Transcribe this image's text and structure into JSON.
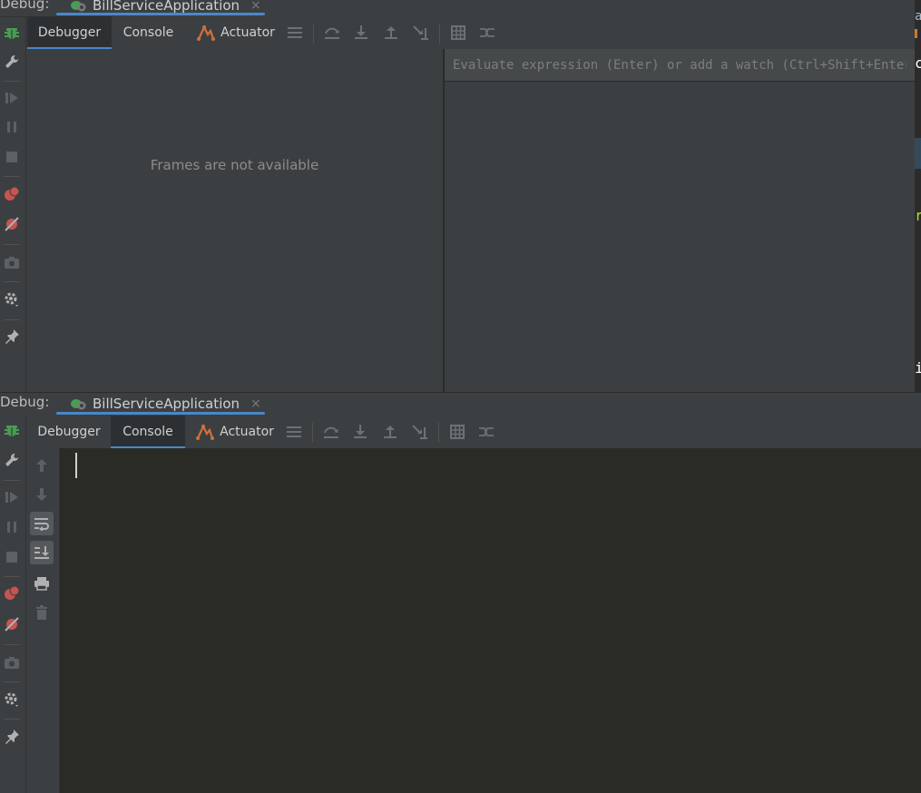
{
  "top_panel": {
    "debug_label": "Debug:",
    "run_config": "BillServiceApplication",
    "close_glyph": "×",
    "tabs": [
      "Debugger",
      "Console",
      "Actuator"
    ],
    "active_tab": "Debugger",
    "frames_message": "Frames are not available",
    "evaluate_placeholder": "Evaluate expression (Enter) or add a watch (Ctrl+Shift+Enter)"
  },
  "bottom_panel": {
    "debug_label": "Debug:",
    "run_config": "BillServiceApplication",
    "close_glyph": "×",
    "tabs": [
      "Debugger",
      "Console",
      "Actuator"
    ],
    "active_tab": "Console",
    "console_text": ""
  },
  "left_toolbar_icons": [
    "bug-icon",
    "wrench-icon",
    "resume-icon",
    "pause-icon",
    "stop-icon",
    "view-breakpoints-icon",
    "mute-breakpoints-icon",
    "camera-icon",
    "settings-icon",
    "pin-icon"
  ],
  "toolbar_icons": [
    "menu-icon",
    "step-over-icon",
    "step-into-icon",
    "step-out-icon",
    "run-to-cursor-icon",
    "evaluate-icon",
    "trace-icon"
  ],
  "console_side_icons": [
    "up-icon",
    "down-icon",
    "soft-wrap-icon",
    "scroll-to-end-icon",
    "print-icon",
    "trash-icon"
  ],
  "editor_edge_glyphs": [
    "a",
    "c",
    "r",
    "i"
  ],
  "colors": {
    "accent_blue": "#4a88c7",
    "panel_bg": "#3c3f41",
    "console_bg": "#2b2b26",
    "breakpoint_red": "#c75450",
    "bug_green": "#499c54",
    "actuator_orange": "#d0703b"
  }
}
